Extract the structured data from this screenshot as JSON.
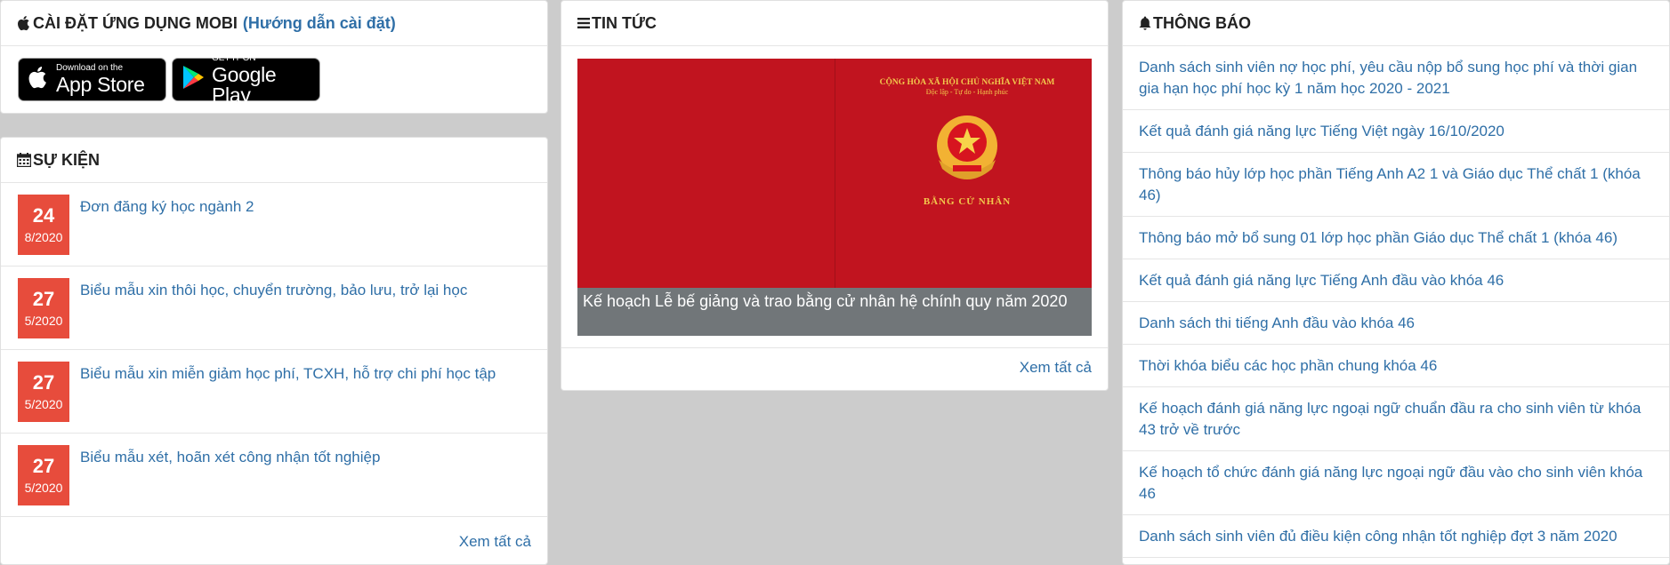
{
  "mobi": {
    "title": "CÀI ĐẶT ỨNG DỤNG MOBI",
    "guide": "(Hướng dẫn cài đặt)",
    "appstore": {
      "small": "Download on the",
      "big": "App Store"
    },
    "googleplay": {
      "small": "GET IT ON",
      "big": "Google Play"
    }
  },
  "events": {
    "title": "SỰ KIỆN",
    "items": [
      {
        "day": "24",
        "month": "8/2020",
        "title": "Đơn đăng ký học ngành 2"
      },
      {
        "day": "27",
        "month": "5/2020",
        "title": "Biểu mẫu xin thôi học, chuyển trường, bảo lưu, trở lại học"
      },
      {
        "day": "27",
        "month": "5/2020",
        "title": "Biểu mẫu xin miễn giảm học phí, TCXH, hỗ trợ chi phí học tập"
      },
      {
        "day": "27",
        "month": "5/2020",
        "title": "Biểu mẫu xét, hoãn xét công nhận tốt nghiệp"
      }
    ],
    "view_all": "Xem tất cả"
  },
  "news": {
    "title": "TIN TỨC",
    "image": {
      "line1": "CỘNG HÒA XÃ HỘI CHỦ NGHĨA VIỆT NAM",
      "line2": "Độc lập - Tự do - Hạnh phúc",
      "cert": "BẰNG CỬ NHÂN"
    },
    "caption": "Kế hoạch Lễ bế giảng và trao bằng cử nhân hệ chính quy năm 2020",
    "view_all": "Xem tất cả"
  },
  "notices": {
    "title": "THÔNG BÁO",
    "items": [
      "Danh sách sinh viên nợ học phí, yêu cầu nộp bổ sung học phí và thời gian gia hạn học phí học kỳ 1 năm học 2020 - 2021",
      "Kết quả đánh giá năng lực Tiếng Việt ngày 16/10/2020",
      "Thông báo hủy lớp học phần Tiếng Anh A2 1 và Giáo dục Thể chất 1 (khóa 46)",
      "Thông báo mở bổ sung 01 lớp học phần Giáo dục Thể chất 1 (khóa 46)",
      "Kết quả đánh giá năng lực Tiếng Anh đầu vào khóa 46",
      "Danh sách thi tiếng Anh đầu vào khóa 46",
      "Thời khóa biểu các học phần chung khóa 46",
      "Kế hoạch đánh giá năng lực ngoại ngữ chuẩn đầu ra cho sinh viên từ khóa 43 trở về trước",
      "Kế hoạch tổ chức đánh giá năng lực ngoại ngữ đầu vào cho sinh viên khóa 46",
      "Danh sách sinh viên đủ điều kiện công nhận tốt nghiệp đợt 3 năm 2020"
    ]
  },
  "colors": {
    "accent": "#2f6fa7",
    "date_box": "#e74c3c",
    "banner_red": "#c1141f"
  }
}
